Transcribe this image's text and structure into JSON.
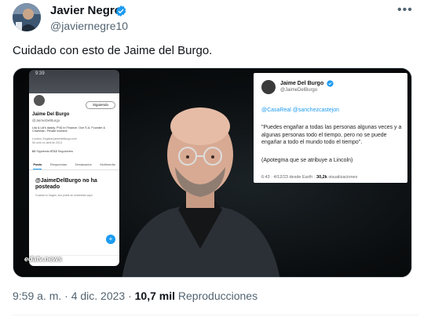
{
  "author": {
    "name": "Javier Negre",
    "handle": "@javiernegre10"
  },
  "tweet": {
    "text": "Cuidado con esto de Jaime del Burgo."
  },
  "media": {
    "phone": {
      "clock": "9:39",
      "follow_label": "Siguiendo",
      "profile_name": "Jaime Del Burgo",
      "profile_handle": "@JaimeDelBurgo",
      "bio": "Lila & Lili's daddy. PhD in Finance. Oce S.A. Founder & Chairman. Private investor.",
      "location": "London, England",
      "link": "jaimedelburgo.com",
      "joined": "Se unió en abril de 2013",
      "following_count": "62",
      "following_label": "Siguiendo",
      "followers_count": "6712",
      "followers_label": "Seguidores",
      "tabs": [
        "Posts",
        "Respuestas",
        "Destacados",
        "Multimedia"
      ],
      "empty_title": "@JaimeDelBurgo no ha posteado",
      "empty_sub": "Cuando lo hagan, sus posts se mostrarán aquí."
    },
    "watermark": "edatv.news",
    "quoted": {
      "name": "Jaime Del Burgo",
      "handle": "@JaimeDelBurgo",
      "mentions": "@CasaReal @sanchezcastejon",
      "quote": "\"Puedes engañar a todas las personas algunas veces y a algunas personas todo el tiempo, pero no se puede engañar a todo el mundo todo el tiempo\".",
      "aside": "(Apotegma que se atribuye a Lincoln)",
      "meta_time": "6:43 · 4/12/23 desde Earth · ",
      "meta_views": "30,2k",
      "meta_views_label": " visualizaciones"
    }
  },
  "footer": {
    "timestamp": "9:59 a. m. · 4 dic. 2023 · ",
    "views": "10,7 mil",
    "views_label": " Reproducciones"
  },
  "colors": {
    "verified": "#1d9bf0",
    "secondary_text": "#536471",
    "link": "#1d9bf0"
  },
  "icons": {
    "verified": "verified-badge-icon",
    "more": "more-options-icon"
  }
}
